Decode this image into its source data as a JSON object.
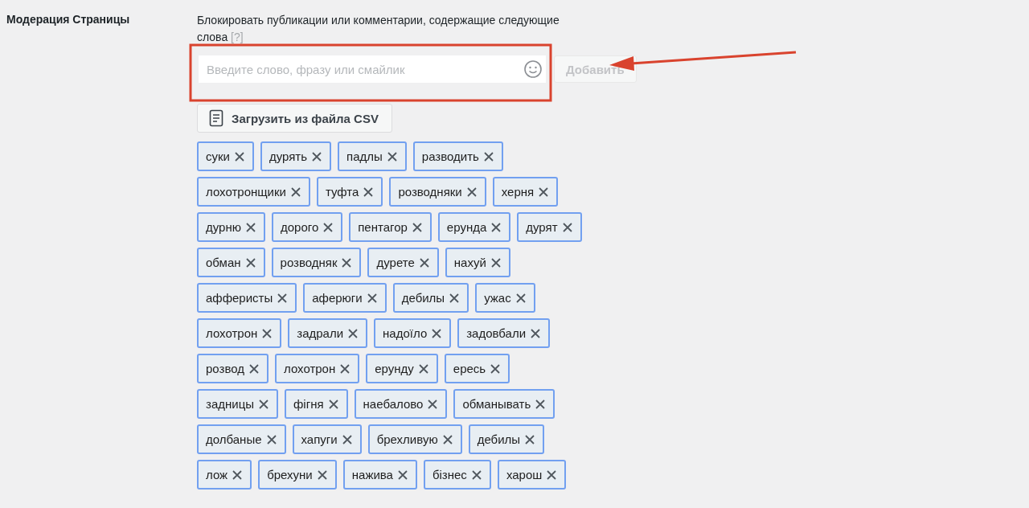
{
  "section_label": "Модерация Страницы",
  "description": "Блокировать публикации или комментарии, содержащие следующие слова",
  "help_link": "[?]",
  "word_input": {
    "placeholder": "Введите слово, фразу или смайлик"
  },
  "add_button": {
    "label": "Добавить",
    "disabled": true
  },
  "csv_button": {
    "label": "Загрузить из файла CSV"
  },
  "tag_rows": [
    [
      "суки",
      "дурять",
      "падлы",
      "разводить"
    ],
    [
      "лохотронщики",
      "туфта",
      "розводняки",
      "херня"
    ],
    [
      "дурню",
      "дорого",
      "пентагор",
      "ерунда",
      "дурят"
    ],
    [
      "обман",
      "розводняк",
      "дурете",
      "нахуй"
    ],
    [
      "афферисты",
      "аферюги",
      "дебилы",
      "ужас"
    ],
    [
      "лохотрон",
      "задрали",
      "надоїло",
      "задовбали"
    ],
    [
      "розвод",
      "лохотрон",
      "ерунду",
      "ересь"
    ],
    [
      "задницы",
      "фігня",
      "наебалово",
      "обманывать"
    ],
    [
      "долбаные",
      "хапуги",
      "брехливую",
      "дебилы"
    ],
    [
      "лож",
      "брехуни",
      "нажива",
      "бізнес",
      "харош"
    ]
  ]
}
